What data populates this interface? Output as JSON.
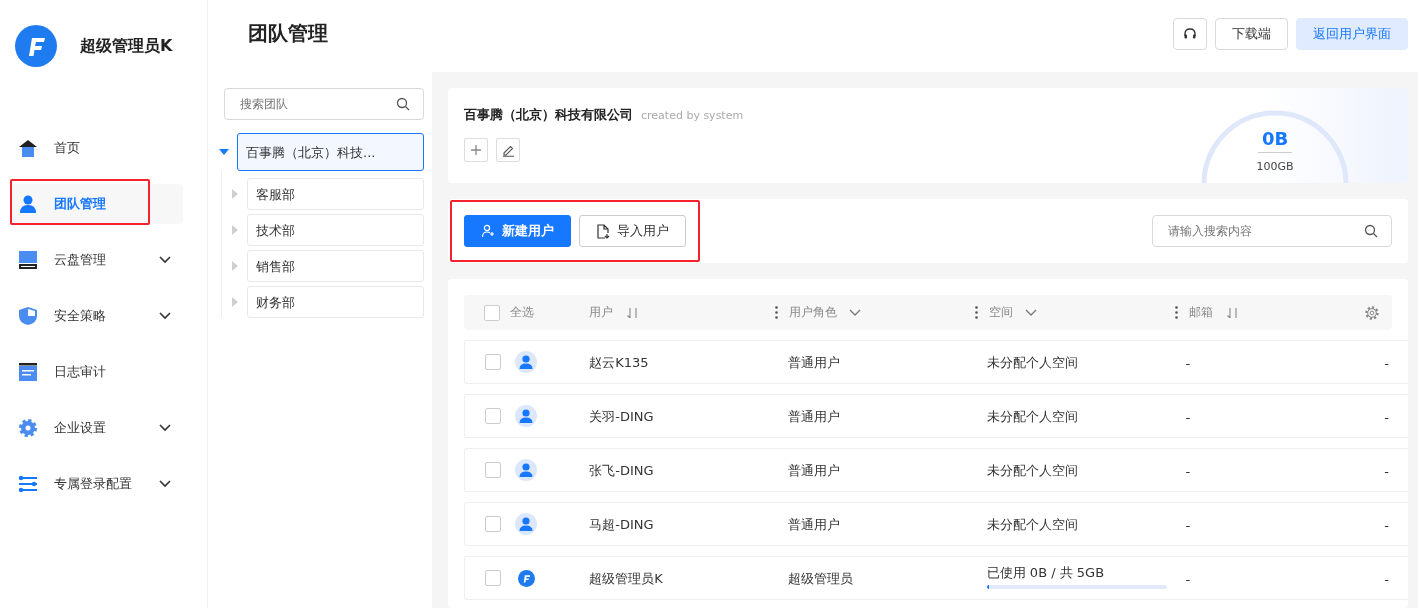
{
  "app": {
    "user_name": "超级管理员K"
  },
  "nav": [
    {
      "label": "首页",
      "selected": false,
      "expandable": false,
      "highlighted": false
    },
    {
      "label": "团队管理",
      "selected": true,
      "expandable": false,
      "highlighted": true
    },
    {
      "label": "云盘管理",
      "selected": false,
      "expandable": true,
      "highlighted": false
    },
    {
      "label": "安全策略",
      "selected": false,
      "expandable": true,
      "highlighted": false
    },
    {
      "label": "日志审计",
      "selected": false,
      "expandable": false,
      "highlighted": false
    },
    {
      "label": "企业设置",
      "selected": false,
      "expandable": true,
      "highlighted": false
    },
    {
      "label": "专属登录配置",
      "selected": false,
      "expandable": true,
      "highlighted": false
    }
  ],
  "page_title": "团队管理",
  "header_buttons": [
    {
      "kind": "icon"
    },
    {
      "kind": "plain",
      "label": "下载端"
    },
    {
      "kind": "primary",
      "label": "返回用户界面"
    }
  ],
  "tree": {
    "search": {
      "placeholder": "搜索团队"
    },
    "root": {
      "label": "百事腾（北京）科技...",
      "selected": true,
      "expanded": true,
      "children": [
        {
          "label": "客服部",
          "selected": false
        },
        {
          "label": "技术部",
          "selected": false
        },
        {
          "label": "销售部",
          "selected": false
        },
        {
          "label": "财务部",
          "selected": false
        }
      ]
    }
  },
  "team": {
    "name": "百事腾（北京）科技有限公司",
    "creator": "created by system",
    "used": "0B",
    "total": "100GB"
  },
  "toolbar": {
    "highlighted": true,
    "buttons": [
      {
        "kind": "primary",
        "label": "新建用户"
      },
      {
        "kind": "plain",
        "label": "导入用户"
      }
    ],
    "search": {
      "placeholder": "请输入搜索内容"
    }
  },
  "table": {
    "select_all": {
      "label": "全选",
      "checked": false
    },
    "columns": [
      {
        "label": "用户",
        "kind": "sortable"
      },
      {
        "label": "用户角色",
        "kind": "filterable"
      },
      {
        "label": "空间",
        "kind": "filterable"
      },
      {
        "label": "邮箱",
        "kind": "sortable"
      }
    ],
    "rows": [
      {
        "checked": false,
        "kind": "member",
        "user": "赵云K135",
        "role": "普通用户",
        "space": {
          "kind": "text",
          "text": "未分配个人空间"
        },
        "email": "-",
        "column_5": "-"
      },
      {
        "checked": false,
        "kind": "member",
        "user": "关羽-DING",
        "role": "普通用户",
        "space": {
          "kind": "text",
          "text": "未分配个人空间"
        },
        "email": "-",
        "column_5": "-"
      },
      {
        "checked": false,
        "kind": "member",
        "user": "张飞-DING",
        "role": "普通用户",
        "space": {
          "kind": "text",
          "text": "未分配个人空间"
        },
        "email": "-",
        "column_5": "-"
      },
      {
        "checked": false,
        "kind": "member",
        "user": "马超-DING",
        "role": "普通用户",
        "space": {
          "kind": "text",
          "text": "未分配个人空间"
        },
        "email": "-",
        "column_5": "-"
      },
      {
        "checked": false,
        "kind": "admin",
        "user": "超级管理员K",
        "role": "超级管理员",
        "space": {
          "kind": "quota",
          "text": "已使用 0B / 共 5GB",
          "level": 0
        },
        "email": "-",
        "column_5": "-"
      }
    ]
  }
}
